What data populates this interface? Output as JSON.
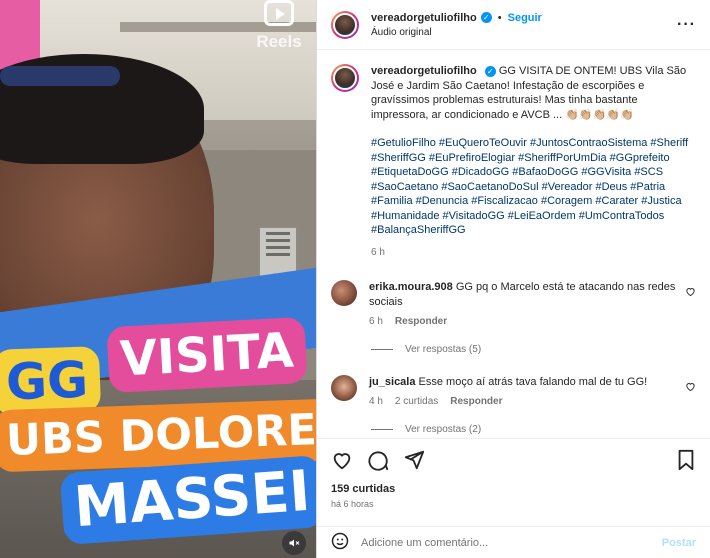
{
  "media": {
    "reels_label": "Reels",
    "overlay_lines": [
      "GG",
      "VISITA",
      "UBS DOLORES",
      "MASSEI"
    ]
  },
  "header": {
    "username": "vereadorgetuliofilho",
    "follow_label": "Seguir",
    "audio_label": "Áudio original",
    "more_label": "···"
  },
  "caption": {
    "username": "vereadorgetuliofilho",
    "text": "GG VISITA DE ONTEM! UBS Vila São José e Jardim São Caetano! Infestação de escorpiões e gravíssimos problemas estruturais! Mas tinha bastante impressora, ar condicionado e AVCB ... 👏🏼👏🏼👏🏼👏🏼👏🏼",
    "hashtags": "#GetulioFilho #EuQueroTeOuvir #JuntosContraoSistema #Sheriff #SheriffGG #EuPrefiroElogiar #SheriffPorUmDia #GGprefeito #EtiquetaDoGG #DicadoGG #BafaoDoGG #GGVisita #SCS #SaoCaetano #SaoCaetanoDoSul #Vereador #Deus #Patria #Familia #Denuncia #Fiscalizacao #Coragem #Carater #Justica #Humanidade #VisitadoGG #LeiEaOrdem #UmContraTodos #BalançaSheriffGG",
    "time": "6 h"
  },
  "comments": [
    {
      "username": "erika.moura.908",
      "text": "GG pq o Marcelo está te atacando nas redes sociais",
      "time": "6 h",
      "likes": "",
      "reply_label": "Responder",
      "view_replies": "Ver respostas (5)"
    },
    {
      "username": "ju_sicala",
      "text": "Esse moço aí atrás tava falando mal de tu GG!",
      "time": "4 h",
      "likes": "2 curtidas",
      "reply_label": "Responder",
      "view_replies": "Ver respostas (2)"
    }
  ],
  "footer": {
    "likes": "159 curtidas",
    "time": "há 6 horas",
    "comment_placeholder": "Adicione um comentário...",
    "post_label": "Postar"
  }
}
